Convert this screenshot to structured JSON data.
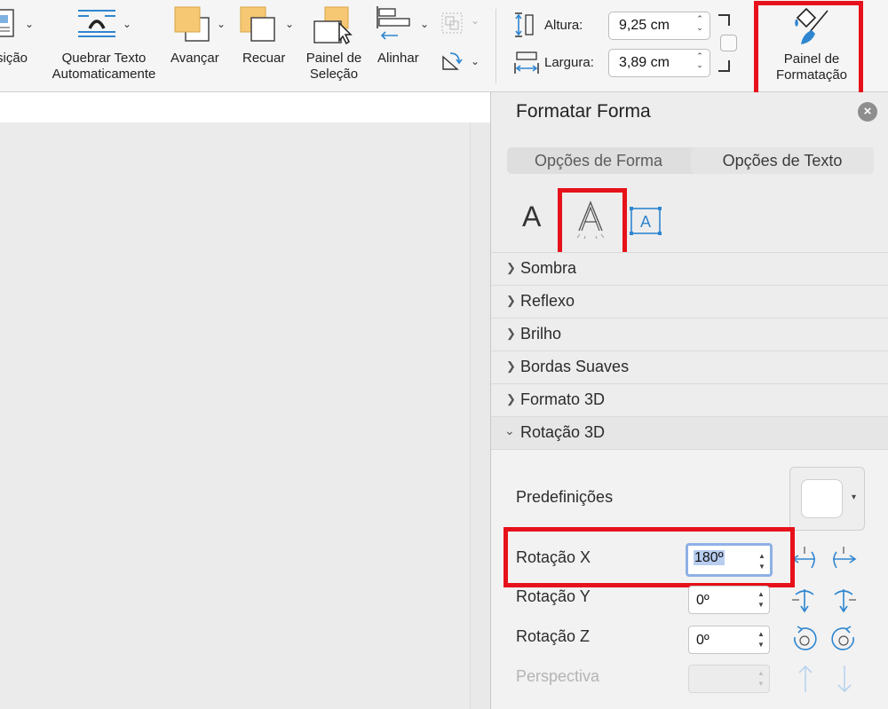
{
  "ribbon": {
    "position_label": "sição",
    "wrap_text_label": "Quebrar Texto\nAutomaticamente",
    "bring_forward_label": "Avançar",
    "send_backward_label": "Recuar",
    "selection_pane_label": "Painel de\nSeleção",
    "align_label": "Alinhar",
    "height_label": "Altura:",
    "height_value": "9,25 cm",
    "width_label": "Largura:",
    "width_value": "3,89 cm",
    "format_pane_label": "Painel de\nFormatação"
  },
  "pane": {
    "title": "Formatar Forma",
    "tabs": [
      "Opções de Forma",
      "Opções de Texto"
    ],
    "icon_tabs": [
      "text-fill-outline",
      "text-effects",
      "textbox-layout"
    ],
    "sections": [
      "Sombra",
      "Reflexo",
      "Brilho",
      "Bordas Suaves",
      "Formato 3D",
      "Rotação 3D"
    ],
    "rotation": {
      "presets_label": "Predefinições",
      "x_label": "Rotação X",
      "x_value": "180º",
      "y_label": "Rotação Y",
      "y_value": "0º",
      "z_label": "Rotação Z",
      "z_value": "0º",
      "perspective_label": "Perspectiva",
      "perspective_value": ""
    }
  },
  "colors": {
    "highlight": "#e6111a",
    "icon_blue": "#2f86d0",
    "shape_orange": "#f7c873",
    "focus_blue": "#8fb0e6"
  }
}
